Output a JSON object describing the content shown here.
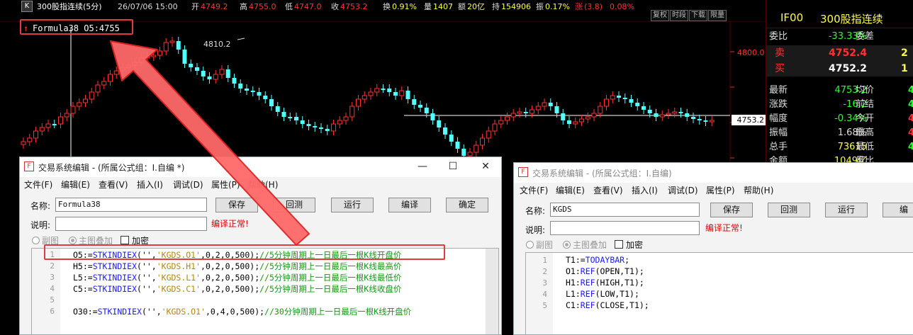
{
  "chart": {
    "k_label": "K",
    "title": "300股指连续(5分)",
    "datetime": "26/07/06 15:00",
    "open_lbl": "开",
    "open": "4749.2",
    "high_lbl": "高",
    "high": "4755.0",
    "low_lbl": "低",
    "low": "4747.0",
    "close_lbl": "收",
    "close": "4753.2",
    "turnover_lbl": "换",
    "turnover": "0.91%",
    "vol_lbl": "量",
    "vol": "1407",
    "amt_lbl": "额",
    "amt": "20亿",
    "hold_lbl": "持",
    "hold": "154906",
    "amp_lbl": "振",
    "amp": "0.17%",
    "chg_lbl": "涨",
    "chg": "(3.8)",
    "chg_pct": "0.08%",
    "tool_buttons": [
      "复权",
      "时段",
      "下载",
      "限量"
    ],
    "formula_tag": "Formula38 O5:4755",
    "high_mark": "4810.2",
    "axis_price": "4800.0",
    "last_price_tag": "4753.2",
    "colors": {
      "up": "#ff3232",
      "down": "#54ffff",
      "label": "#c8c8c8"
    }
  },
  "quote": {
    "code": "IF00",
    "name": "300股指连续",
    "rows": [
      {
        "l": "委比",
        "v": "-33.33%",
        "l2": "委差",
        "v2": ""
      },
      {
        "l": "卖",
        "v": "4752.4",
        "l2": "",
        "v2": "2"
      },
      {
        "l": "买",
        "v": "4752.2",
        "l2": "",
        "v2": "1"
      },
      {
        "l": "最新",
        "v": "4753.2",
        "l2": "均价",
        "v2": "4"
      },
      {
        "l": "涨跌",
        "v": "-16.2",
        "l2": "前结",
        "v2": "4"
      },
      {
        "l": "幅度",
        "v": "-0.34%",
        "l2": "今开",
        "v2": "4"
      },
      {
        "l": "振幅",
        "v": "1.68%",
        "l2": "最高",
        "v2": "4"
      },
      {
        "l": "总手",
        "v": "73615",
        "l2": "最低",
        "v2": "4"
      },
      {
        "l": "金额",
        "v": "1049亿",
        "l2": "量比",
        "v2": ""
      }
    ]
  },
  "dialog1": {
    "title": "交易系统编辑 - (所属公式组：I.自编 *)",
    "menu": [
      "文件(F)",
      "编辑(E)",
      "查看(V)",
      "插入(I)",
      "调试(D)",
      "属性(P)",
      "帮助(H)"
    ],
    "name_label": "名称:",
    "name_value": "Formula38",
    "desc_label": "说明:",
    "buttons": [
      "保存",
      "回测",
      "运行",
      "编译",
      "确定"
    ],
    "status": "编译正常!",
    "opt_chart": "副图",
    "opt_overlay": "主图叠加",
    "opt_encrypt": "加密",
    "lines": [
      {
        "n": "1",
        "var": "O5:=",
        "fn": "STKINDIEX",
        "a": "('',",
        "s": "'KGDS.O1'",
        "b": ",0,2,0,500);",
        "cm": "//5分钟周期上一日最后一根K线开盘价"
      },
      {
        "n": "2",
        "var": "H5:=",
        "fn": "STKINDIEX",
        "a": "('',",
        "s": "'KGDS.H1'",
        "b": ",0,2,0,500);",
        "cm": "//5分钟周期上一日最后一根K线最高价"
      },
      {
        "n": "3",
        "var": "L5:=",
        "fn": "STKINDIEX",
        "a": "('',",
        "s": "'KGDS.L1'",
        "b": ",0,2,0,500);",
        "cm": "//5分钟周期上一日最后一根K线最低价"
      },
      {
        "n": "4",
        "var": "C5:=",
        "fn": "STKINDIEX",
        "a": "('',",
        "s": "'KGDS.C1'",
        "b": ",0,2,0,500);",
        "cm": "//5分钟周期上一日最后一根K线收盘价"
      },
      {
        "n": "5",
        "var": "",
        "fn": "",
        "a": "",
        "s": "",
        "b": "",
        "cm": ""
      },
      {
        "n": "6",
        "var": "O30:=",
        "fn": "STKINDIEX",
        "a": "('',",
        "s": "'KGDS.O1'",
        "b": ",0,4,0,500);",
        "cm": "//30分钟周期上一日最后一根K线开盘价"
      }
    ]
  },
  "dialog2": {
    "title": "交易系统编辑 - (所属公式组：I.自编)",
    "menu": [
      "文件(F)",
      "编辑(E)",
      "查看(V)",
      "插入(I)",
      "调试(D)",
      "属性(P)",
      "帮助(H)"
    ],
    "name_label": "名称:",
    "name_value": "KGDS",
    "desc_label": "说明:",
    "buttons": [
      "保存",
      "回测",
      "运行",
      "编"
    ],
    "status": "编译正常!",
    "opt_chart": "副图",
    "opt_overlay": "主图叠加",
    "opt_encrypt": "加密",
    "lines": [
      {
        "n": "1",
        "var": "T1:=",
        "fn": "TODAYBAR",
        "rest": ";"
      },
      {
        "n": "2",
        "var": "O1:",
        "fn": "REF",
        "rest": "(OPEN,T1);"
      },
      {
        "n": "3",
        "var": "H1:",
        "fn": "REF",
        "rest": "(HIGH,T1);"
      },
      {
        "n": "4",
        "var": "L1:",
        "fn": "REF",
        "rest": "(LOW,T1);"
      },
      {
        "n": "5",
        "var": "C1:",
        "fn": "REF",
        "rest": "(CLOSE,T1);"
      }
    ]
  }
}
